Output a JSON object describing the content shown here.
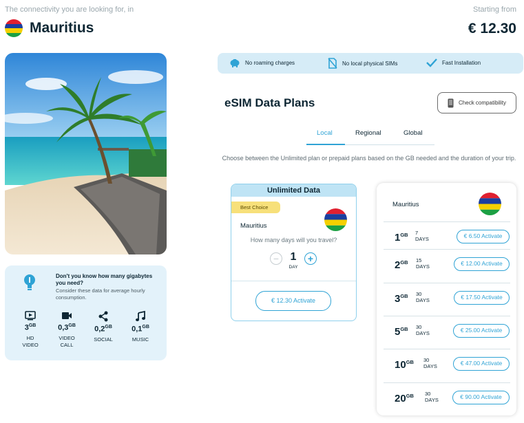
{
  "header": {
    "tagline": "The connectivity you are looking for, in",
    "country": "Mauritius",
    "starting_label": "Starting from",
    "starting_price": "€ 12.30"
  },
  "flag_colors": [
    "#e02030",
    "#1a3fa0",
    "#f5d000",
    "#1ca043"
  ],
  "features": [
    {
      "icon": "piggy-bank-icon",
      "label": "No roaming charges"
    },
    {
      "icon": "no-sim-icon",
      "label": "No local physical SIMs"
    },
    {
      "icon": "checkmark-icon",
      "label": "Fast Installation"
    }
  ],
  "plans": {
    "title": "eSIM Data Plans",
    "check_compat": "Check compatibility",
    "tabs": [
      "Local",
      "Regional",
      "Global"
    ],
    "active_tab": "Local",
    "description": "Choose between the Unlimited plan or prepaid plans based on the GB needed and the duration of your trip."
  },
  "unlimited": {
    "header": "Unlimited Data",
    "badge": "Best Choice",
    "country": "Mauritius",
    "question": "How many days will you travel?",
    "minus": "−",
    "plus": "+",
    "days_value": "1",
    "days_unit": "DAY",
    "activate_label": "€ 12.30 Activate"
  },
  "prepaid": {
    "country": "Mauritius",
    "rows": [
      {
        "gb": "1",
        "unit": "GB",
        "days": "7",
        "days_unit": "DAYS",
        "button": "€ 6.50 Activate"
      },
      {
        "gb": "2",
        "unit": "GB",
        "days": "15",
        "days_unit": "DAYS",
        "button": "€ 12.00 Activate"
      },
      {
        "gb": "3",
        "unit": "GB",
        "days": "30",
        "days_unit": "DAYS",
        "button": "€ 17.50 Activate"
      },
      {
        "gb": "5",
        "unit": "GB",
        "days": "30",
        "days_unit": "DAYS",
        "button": "€ 25.00 Activate"
      },
      {
        "gb": "10",
        "unit": "GB",
        "days": "30",
        "days_unit": "DAYS",
        "button": "€ 47.00 Activate"
      },
      {
        "gb": "20",
        "unit": "GB",
        "days": "30",
        "days_unit": "DAYS",
        "button": "€ 90.00 Activate"
      }
    ]
  },
  "gb_helper": {
    "question": "Don't you know how many gigabytes you need?",
    "subtext": "Consider these data for average hourly consumption.",
    "usages": [
      {
        "icon": "video-icon",
        "amount": "3",
        "unit": "GB",
        "label_1": "HD",
        "label_2": "VIDEO"
      },
      {
        "icon": "video-call-icon",
        "amount": "0,3",
        "unit": "GB",
        "label_1": "VIDEO",
        "label_2": "CALL"
      },
      {
        "icon": "share-icon",
        "amount": "0,2",
        "unit": "GB",
        "label_1": "SOCIAL",
        "label_2": ""
      },
      {
        "icon": "music-icon",
        "amount": "0,1",
        "unit": "GB",
        "label_1": "MUSIC",
        "label_2": ""
      }
    ]
  },
  "colors": {
    "accent": "#2fa3d5",
    "dark": "#0d2633",
    "feature_bg": "#d6ecf7",
    "badge": "#f7e07a"
  }
}
